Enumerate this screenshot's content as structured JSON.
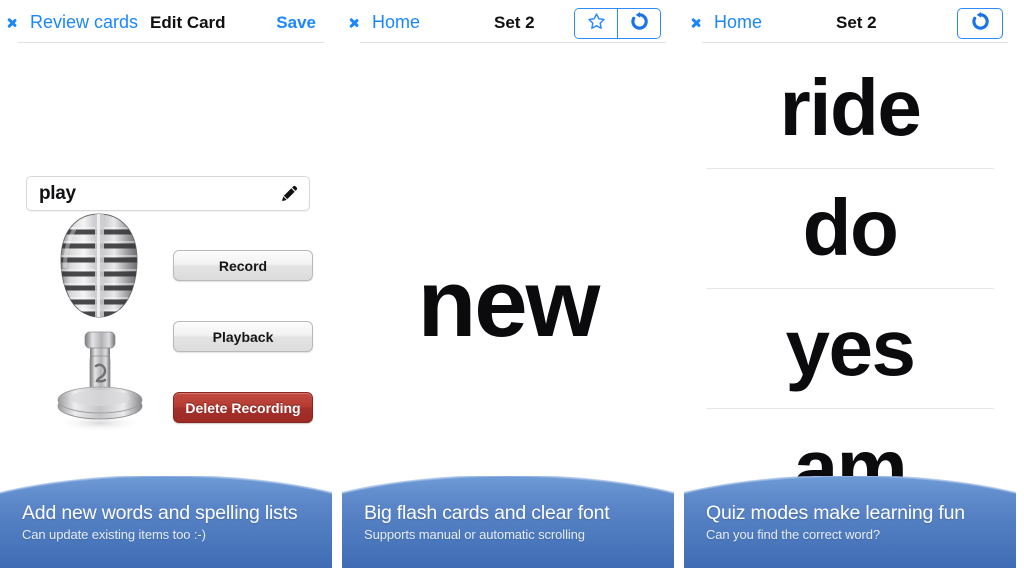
{
  "screens": [
    {
      "nav": {
        "back_label": "Review cards",
        "title": "Edit Card",
        "action_label": "Save"
      },
      "word_field": {
        "value": "play",
        "edit_icon": "pencil-icon"
      },
      "mic_icon": "microphone-image",
      "buttons": [
        {
          "label": "Record"
        },
        {
          "label": "Playback"
        },
        {
          "label": "Delete Recording"
        }
      ],
      "caption": {
        "title": "Add new words and spelling lists",
        "subtitle": "Can update existing items too :-)"
      }
    },
    {
      "nav": {
        "back_label": "Home",
        "title": "Set 2",
        "segmented": [
          {
            "icon": "star-outline-icon"
          },
          {
            "icon": "rotate-refresh-icon"
          }
        ]
      },
      "flashcard_word": "new",
      "caption": {
        "title": "Big flash cards and clear font",
        "subtitle": "Supports manual or automatic scrolling"
      }
    },
    {
      "nav": {
        "back_label": "Home",
        "title": "Set 2",
        "action_icon": "rotate-refresh-icon"
      },
      "word_list": [
        "ride",
        "do",
        "yes",
        "am"
      ],
      "caption": {
        "title": "Quiz modes make learning fun",
        "subtitle": "Can you find the correct word?"
      }
    }
  ],
  "colors": {
    "accent_blue": "#1a87ff",
    "caption_blue": "#4a7fc8",
    "danger_red": "#b53b32",
    "text_dark": "#111114"
  }
}
